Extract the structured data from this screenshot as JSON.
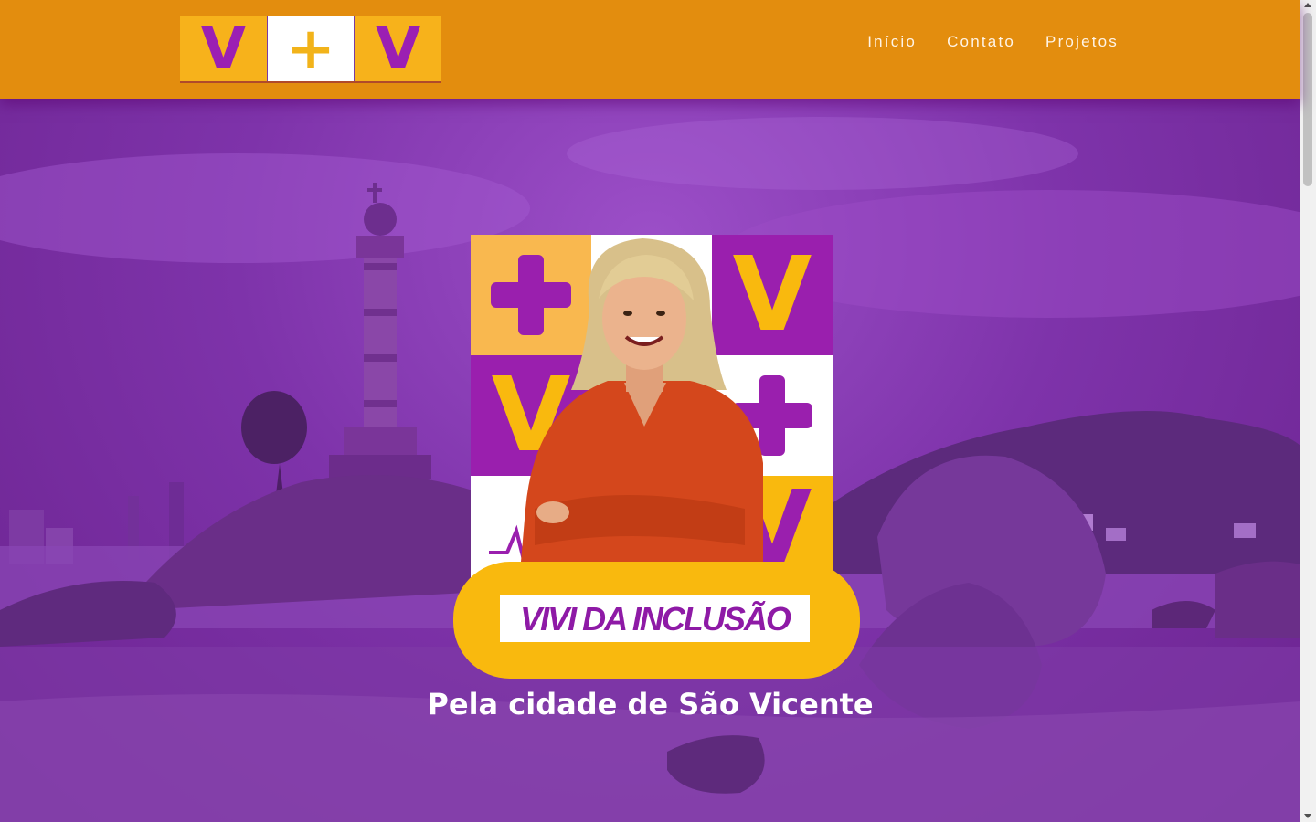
{
  "header": {
    "logo": {
      "left": "V",
      "middle": "+",
      "right": "V"
    },
    "nav": [
      {
        "label": "Início"
      },
      {
        "label": "Contato"
      },
      {
        "label": "Projetos"
      }
    ]
  },
  "hero": {
    "card_glyphs": {
      "v": "V",
      "plus": "+"
    },
    "banner_label": "VIVI DA INCLUSÃO",
    "subtitle": "Pela cidade de São Vicente"
  },
  "colors": {
    "header_bg": "#e38d0e",
    "brand_purple": "#9a1fae",
    "brand_yellow": "#f9b90e",
    "overlay_purple": "#7e33aa"
  }
}
